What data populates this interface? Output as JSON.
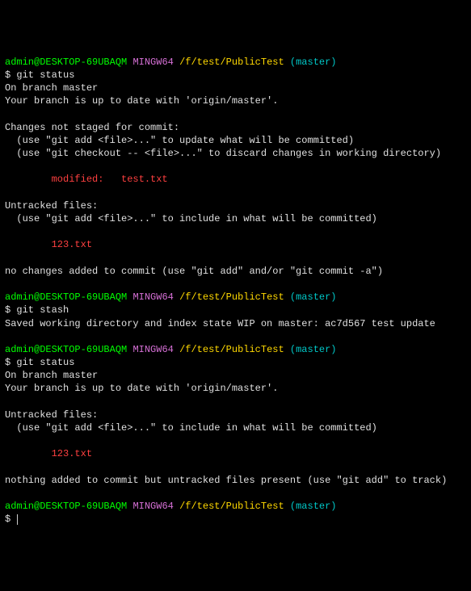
{
  "prompt": {
    "user_host": "admin@DESKTOP-69UBAQM",
    "env": "MINGW64",
    "path": "/f/test/PublicTest",
    "branch": "(master)"
  },
  "dollar": "$ ",
  "blocks": [
    {
      "cmd": "git status",
      "out": [
        {
          "t": "On branch master"
        },
        {
          "t": "Your branch is up to date with 'origin/master'."
        },
        {
          "t": ""
        },
        {
          "t": "Changes not staged for commit:"
        },
        {
          "t": "  (use \"git add <file>...\" to update what will be committed)"
        },
        {
          "t": "  (use \"git checkout -- <file>...\" to discard changes in working directory)"
        },
        {
          "t": ""
        },
        {
          "t": "        modified:   test.txt",
          "c": "red"
        },
        {
          "t": ""
        },
        {
          "t": "Untracked files:"
        },
        {
          "t": "  (use \"git add <file>...\" to include in what will be committed)"
        },
        {
          "t": ""
        },
        {
          "t": "        123.txt",
          "c": "red"
        },
        {
          "t": ""
        },
        {
          "t": "no changes added to commit (use \"git add\" and/or \"git commit -a\")"
        },
        {
          "t": ""
        }
      ]
    },
    {
      "cmd": "git stash",
      "out": [
        {
          "t": "Saved working directory and index state WIP on master: ac7d567 test update"
        },
        {
          "t": ""
        }
      ]
    },
    {
      "cmd": "git status",
      "out": [
        {
          "t": "On branch master"
        },
        {
          "t": "Your branch is up to date with 'origin/master'."
        },
        {
          "t": ""
        },
        {
          "t": "Untracked files:"
        },
        {
          "t": "  (use \"git add <file>...\" to include in what will be committed)"
        },
        {
          "t": ""
        },
        {
          "t": "        123.txt",
          "c": "red"
        },
        {
          "t": ""
        },
        {
          "t": "nothing added to commit but untracked files present (use \"git add\" to track)"
        },
        {
          "t": ""
        }
      ]
    }
  ]
}
